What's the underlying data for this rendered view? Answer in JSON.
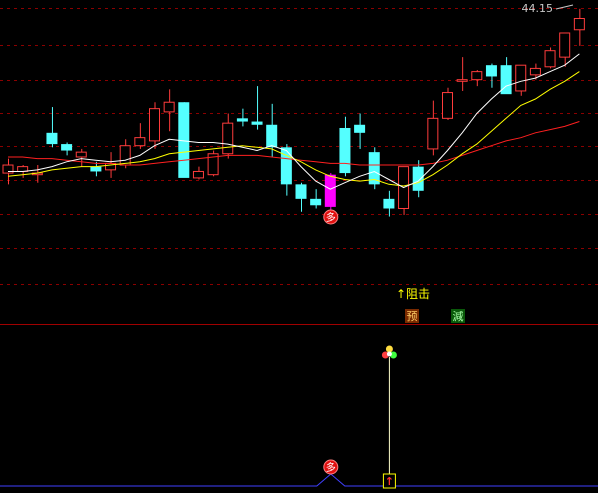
{
  "chart_data": {
    "type": "candlestick",
    "price_axis": {
      "ylim": [
        25.2,
        44.7
      ]
    },
    "last_price_label": "44.15",
    "colors": {
      "background": "#000000",
      "grid": "#8b0000",
      "up_candle": "#ff3c3c",
      "down_candle": "#54ffff",
      "special_candle": "#ff00ff",
      "ma_short": "#ffffff",
      "ma_mid": "#ffff00",
      "ma_long": "#ff2020",
      "text": "#c8c8c8",
      "annotation": "#ffff00",
      "indicator_baseline": "#4040ff",
      "indicator_line": "#ffffcc"
    },
    "candles": [
      [
        34.2,
        35.1,
        33.5,
        34.7
      ],
      [
        34.3,
        34.7,
        33.9,
        34.6
      ],
      [
        34.1,
        34.7,
        33.6,
        34.2
      ],
      [
        36.7,
        38.3,
        35.8,
        36.0
      ],
      [
        36.0,
        36.1,
        35.3,
        35.6
      ],
      [
        35.2,
        35.7,
        34.6,
        35.5
      ],
      [
        34.6,
        34.9,
        34.0,
        34.3
      ],
      [
        34.4,
        35.5,
        33.9,
        34.8
      ],
      [
        34.7,
        36.3,
        34.5,
        35.9
      ],
      [
        35.9,
        37.3,
        35.7,
        36.4
      ],
      [
        36.2,
        38.6,
        35.7,
        38.2
      ],
      [
        38.0,
        39.4,
        36.8,
        38.6
      ],
      [
        38.6,
        38.6,
        35.0,
        33.9
      ],
      [
        33.9,
        34.6,
        33.8,
        34.3
      ],
      [
        34.1,
        35.6,
        34.0,
        35.4
      ],
      [
        35.4,
        37.9,
        35.1,
        37.3
      ],
      [
        37.6,
        38.2,
        37.1,
        37.4
      ],
      [
        37.4,
        39.6,
        36.9,
        37.2
      ],
      [
        37.2,
        38.5,
        35.2,
        35.8
      ],
      [
        35.8,
        36.0,
        32.8,
        33.5
      ],
      [
        33.5,
        33.6,
        31.8,
        32.6
      ],
      [
        32.6,
        33.2,
        32.0,
        32.2
      ],
      [
        32.1,
        34.2,
        31.8,
        34.1
      ],
      [
        37.0,
        37.7,
        34.0,
        34.2
      ],
      [
        37.2,
        37.9,
        35.7,
        36.7
      ],
      [
        35.5,
        35.8,
        33.2,
        33.5
      ],
      [
        32.6,
        33.1,
        31.5,
        32.0
      ],
      [
        32.0,
        34.4,
        31.6,
        34.6
      ],
      [
        34.6,
        35.0,
        32.7,
        33.1
      ],
      [
        35.7,
        38.7,
        35.3,
        37.6
      ],
      [
        37.6,
        39.5,
        37.5,
        39.2
      ],
      [
        39.9,
        41.4,
        39.3,
        40.0
      ],
      [
        40.0,
        40.6,
        39.6,
        40.5
      ],
      [
        40.9,
        41.0,
        39.5,
        40.2
      ],
      [
        40.9,
        41.4,
        39.3,
        39.1
      ],
      [
        39.3,
        40.7,
        39.0,
        40.9
      ],
      [
        40.3,
        41.0,
        40.0,
        40.7
      ],
      [
        40.8,
        42.0,
        40.7,
        41.8
      ],
      [
        41.4,
        42.6,
        40.8,
        42.9
      ],
      [
        43.1,
        44.4,
        42.1,
        43.8
      ]
    ],
    "ma_short": [
      34.3,
      34.3,
      34.4,
      34.6,
      34.9,
      35.1,
      35.0,
      34.9,
      35.0,
      35.3,
      35.9,
      36.3,
      36.2,
      36.1,
      36.1,
      36.0,
      35.8,
      35.6,
      35.9,
      35.6,
      34.6,
      33.7,
      33.2,
      33.6,
      34.0,
      34.3,
      33.8,
      33.3,
      33.7,
      34.6,
      35.6,
      36.7,
      37.9,
      38.8,
      39.6,
      39.9,
      40.1,
      40.5,
      40.9,
      41.6
    ],
    "ma_mid": [
      34.0,
      34.1,
      34.2,
      34.4,
      34.5,
      34.6,
      34.6,
      34.7,
      34.8,
      34.9,
      35.1,
      35.4,
      35.5,
      35.6,
      35.7,
      35.8,
      35.9,
      35.8,
      35.7,
      35.3,
      34.9,
      34.4,
      34.0,
      33.8,
      33.7,
      33.8,
      33.5,
      33.4,
      33.6,
      34.1,
      34.7,
      35.4,
      36.0,
      36.8,
      37.6,
      38.4,
      38.8,
      39.4,
      39.9,
      40.5
    ],
    "ma_long": [
      35.2,
      35.2,
      35.1,
      35.1,
      35.0,
      34.9,
      34.8,
      34.8,
      34.7,
      34.7,
      34.8,
      34.9,
      35.0,
      35.1,
      35.2,
      35.3,
      35.3,
      35.3,
      35.2,
      35.1,
      35.0,
      34.9,
      34.8,
      34.8,
      34.7,
      34.7,
      34.7,
      34.7,
      34.7,
      34.8,
      35.0,
      35.3,
      35.6,
      35.9,
      36.2,
      36.4,
      36.7,
      36.9,
      37.1,
      37.4
    ],
    "markers": [
      {
        "candle": 22,
        "label": "多"
      }
    ],
    "annotations": {
      "resistance_label": "↑阻击",
      "pre_label": "预",
      "reduce_label": "減"
    },
    "indicator": {
      "signals": [
        {
          "candle": 22,
          "label": "多"
        },
        {
          "candle": 26,
          "label": "↑"
        }
      ]
    }
  }
}
